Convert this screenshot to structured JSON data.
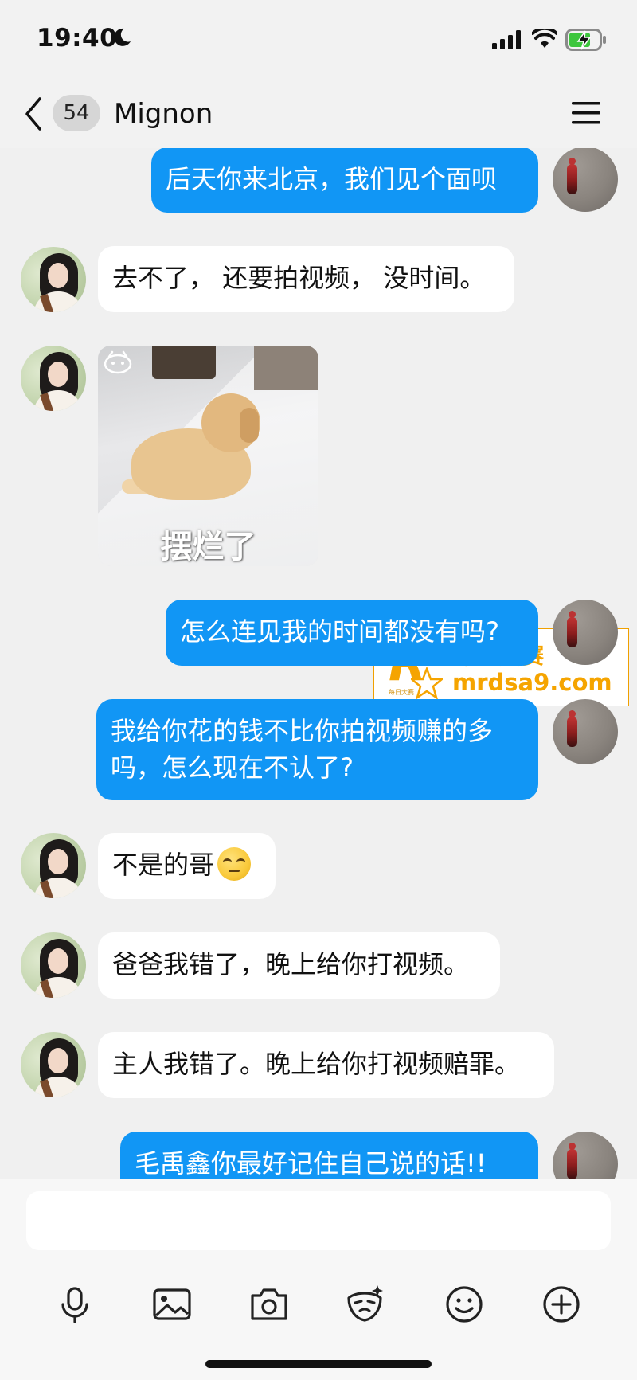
{
  "status_bar": {
    "time": "19:40",
    "icons": [
      "moon-icon",
      "signal-icon",
      "wifi-icon",
      "battery-charging-icon"
    ]
  },
  "header": {
    "back_icon": "chevron-left-icon",
    "unread_count": "54",
    "contact_name": "Mignon",
    "menu_icon": "hamburger-menu-icon"
  },
  "messages": [
    {
      "side": "out",
      "text": "后天你来北京，我们见个面呗"
    },
    {
      "side": "in",
      "text": "去不了， 还要拍视频， 没时间。"
    },
    {
      "side": "in",
      "type": "sticker",
      "caption": "摆烂了"
    },
    {
      "side": "out",
      "text": "怎么连见我的时间都没有吗?"
    },
    {
      "side": "out",
      "text": "我给你花的钱不比你拍视频赚的多吗，怎么现在不认了?"
    },
    {
      "side": "in",
      "text": "不是的哥",
      "emoji": "smirk-emoji"
    },
    {
      "side": "in",
      "text": "爸爸我错了，晚上给你打视频。"
    },
    {
      "side": "in",
      "text": "主人我错了。晚上给你打视频赔罪。"
    },
    {
      "side": "out",
      "text": "毛禹鑫你最好记住自己说的话!!"
    }
  ],
  "watermark": {
    "logo_letter": "R",
    "logo_small_text": "每日大赛",
    "title": "每日大赛",
    "url": "mrdsa9.com"
  },
  "input_bar": {
    "value": "",
    "toolbar_icons": [
      "microphone-icon",
      "image-icon",
      "camera-icon",
      "sticker-face-icon",
      "emoji-icon",
      "plus-icon"
    ]
  },
  "colors": {
    "outgoing_bubble": "#1196f5",
    "incoming_bubble": "#ffffff",
    "chat_background": "#f0f0f0",
    "watermark_accent": "#f5a400"
  }
}
